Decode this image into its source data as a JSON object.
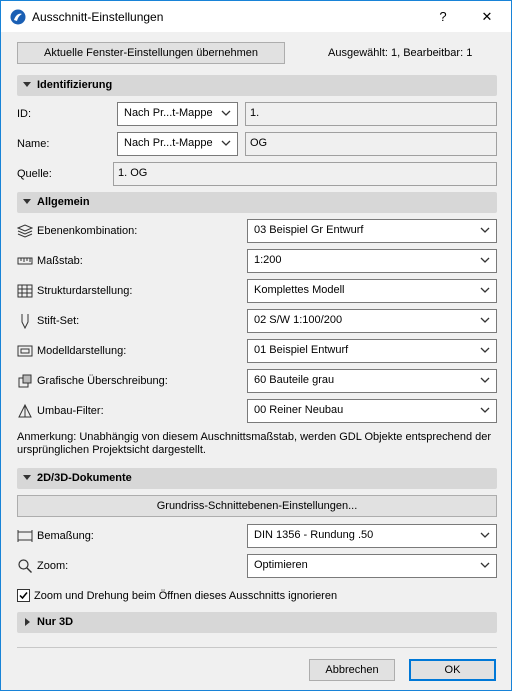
{
  "window": {
    "title": "Ausschnitt-Einstellungen",
    "help": "?",
    "close": "✕"
  },
  "top": {
    "apply_label": "Aktuelle Fenster-Einstellungen übernehmen",
    "status": "Ausgewählt: 1, Bearbeitbar: 1"
  },
  "identification": {
    "header": "Identifizierung",
    "id_label": "ID:",
    "id_mode": "Nach Pr...t-Mappe",
    "id_value": "1.",
    "name_label": "Name:",
    "name_mode": "Nach Pr...t-Mappe",
    "name_value": "OG",
    "source_label": "Quelle:",
    "source_value": "1. OG"
  },
  "general": {
    "header": "Allgemein",
    "rows": [
      {
        "label": "Ebenenkombination:",
        "value": "03 Beispiel Gr Entwurf",
        "icon": "layers-icon"
      },
      {
        "label": "Maßstab:",
        "value": "1:200",
        "icon": "ruler-icon"
      },
      {
        "label": "Strukturdarstellung:",
        "value": "Komplettes Modell",
        "icon": "structure-icon"
      },
      {
        "label": "Stift-Set:",
        "value": "02 S/W 1:100/200",
        "icon": "pen-icon"
      },
      {
        "label": "Modelldarstellung:",
        "value": "01 Beispiel Entwurf",
        "icon": "model-display-icon"
      },
      {
        "label": "Grafische Überschreibung:",
        "value": "60 Bauteile grau",
        "icon": "graphic-override-icon"
      },
      {
        "label": "Umbau-Filter:",
        "value": "00 Reiner Neubau",
        "icon": "renovation-filter-icon"
      }
    ],
    "note": "Anmerkung: Unabhängig von diesem Auschnittsmaßstab, werden GDL Objekte entsprechend der ursprünglichen Projektsicht dargestellt."
  },
  "docs": {
    "header": "2D/3D-Dokumente",
    "cutplane_button": "Grundriss-Schnittebenen-Einstellungen...",
    "dimension_label": "Bemaßung:",
    "dimension_value": "DIN 1356 - Rundung .50",
    "zoom_label": "Zoom:",
    "zoom_value": "Optimieren",
    "ignore_zoom_label": "Zoom und Drehung beim Öffnen dieses Ausschnitts ignorieren",
    "ignore_zoom_checked": true
  },
  "only3d": {
    "header": "Nur 3D"
  },
  "footer": {
    "cancel": "Abbrechen",
    "ok": "OK"
  },
  "colors": {
    "accent": "#0078d7",
    "window_border": "#1883d7",
    "section_bg": "#d7d7d7",
    "dialog_bg": "#f0f0f0"
  }
}
